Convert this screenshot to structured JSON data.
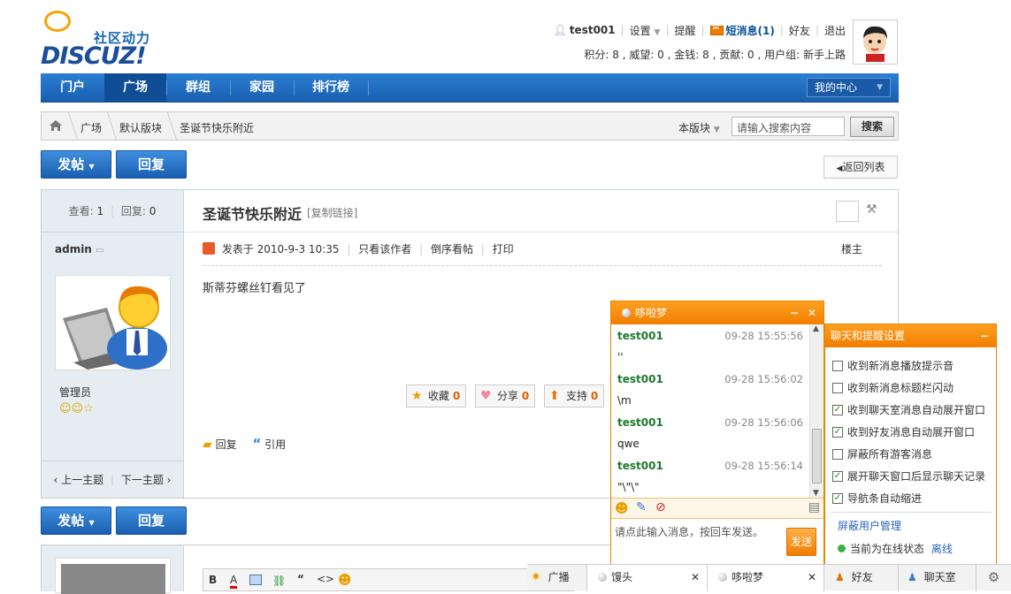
{
  "logo": {
    "slogan": "社区动力",
    "word": "DISCUZ!"
  },
  "userbar": {
    "username": "test001",
    "settings": "设置",
    "remind": "提醒",
    "pm": "短消息(1)",
    "friends": "好友",
    "logout": "退出"
  },
  "credits": "积分: 8 , 威望: 0 , 金钱: 8 , 贡献: 0 , 用户组: 新手上路",
  "nav": {
    "items": [
      "门户",
      "广场",
      "群组",
      "家园",
      "排行榜"
    ],
    "active": "广场",
    "my_center": "我的中心"
  },
  "breadcrumb": {
    "items": [
      "广场",
      "默认版块",
      "圣诞节快乐附近"
    ],
    "scope": "本版块",
    "search_placeholder": "请输入搜索内容",
    "search_button": "搜索"
  },
  "buttons": {
    "post": "发帖",
    "reply": "回复",
    "back_to_list": "返回列表"
  },
  "thread": {
    "views_label": "查看:",
    "views": "1",
    "replies_label": "回复:",
    "replies": "0",
    "title": "圣诞节快乐附近",
    "copy_link": "[复制链接]",
    "author": "admin",
    "role": "管理员",
    "posted_at": "发表于 2010-9-3 10:35",
    "only_author": "只看该作者",
    "reverse": "倒序看帖",
    "print": "打印",
    "floor": "楼主",
    "content": "斯蒂芬螺丝钉看见了",
    "actions": [
      {
        "label": "收藏",
        "count": "0"
      },
      {
        "label": "分享",
        "count": "0"
      },
      {
        "label": "支持",
        "count": "0"
      }
    ],
    "reply": "回复",
    "quote": "引用",
    "prev": "‹ 上一主题",
    "next": "下一主题 ›"
  },
  "editor_tools": [
    "B",
    "A",
    "",
    "",
    "“",
    "<>",
    ""
  ],
  "chat": {
    "title": "哆啦梦",
    "messages": [
      {
        "user": "test001",
        "time": "09-28 15:55:56",
        "text": "''"
      },
      {
        "user": "test001",
        "time": "09-28 15:56:02",
        "text": "\\m"
      },
      {
        "user": "test001",
        "time": "09-28 15:56:06",
        "text": "qwe"
      },
      {
        "user": "test001",
        "time": "09-28 15:56:14",
        "text": "\"\\\"\\\""
      }
    ],
    "input_placeholder": "请点此输入消息，按回车发送。",
    "send": "发送"
  },
  "settings": {
    "title": "聊天和提醒设置",
    "options": [
      {
        "label": "收到新消息播放提示音",
        "checked": false
      },
      {
        "label": "收到新消息标题栏闪动",
        "checked": false
      },
      {
        "label": "收到聊天室消息自动展开窗口",
        "checked": true
      },
      {
        "label": "收到好友消息自动展开窗口",
        "checked": true
      },
      {
        "label": "屏蔽所有游客消息",
        "checked": false
      },
      {
        "label": "展开聊天窗口后显示聊天记录",
        "checked": true
      },
      {
        "label": "导航条自动缩进",
        "checked": true
      }
    ],
    "block_users": "屏蔽用户管理",
    "status_label": "当前为在线状态",
    "offline": "离线"
  },
  "taskbar": {
    "broadcast": "广播",
    "tab1": "馒头",
    "tab2": "哆啦梦",
    "friends": "好友",
    "chatroom": "聊天室"
  },
  "colors": {
    "nav_blue": "#1a5fae",
    "chat_orange": "#f17e00",
    "user_green": "#1d7a2c"
  }
}
